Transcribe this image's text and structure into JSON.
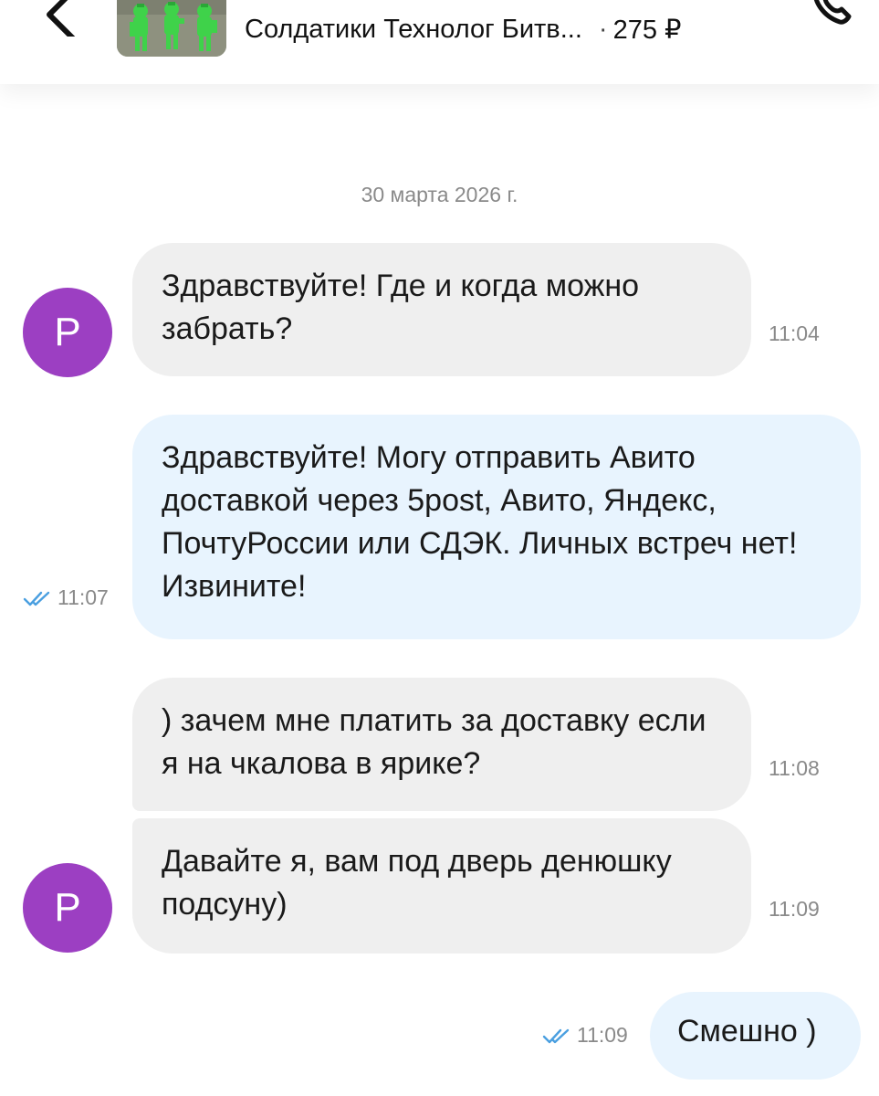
{
  "header": {
    "title": "Солдатики Технолог Битв...",
    "separator": "·",
    "price": "275 ₽",
    "thumbnail_icon": "product-thumbnail"
  },
  "chat": {
    "date": "30 марта 2026 г.",
    "avatar_letter": "P",
    "avatar_color": "#9c3fc2",
    "messages": [
      {
        "direction": "incoming",
        "text": "Здравствуйте! Где и когда можно забрать?",
        "time": "11:04"
      },
      {
        "direction": "outgoing",
        "text": "Здравствуйте! Могу отправить Авито доставкой через 5post, Авито, Яндекс, ПочтуРоссии или СДЭК. Личных встреч нет! Извините!",
        "time": "11:07",
        "read": true
      },
      {
        "direction": "incoming",
        "text": ") зачем мне платить за доставку если я на чкалова в ярике?",
        "time": "11:08"
      },
      {
        "direction": "incoming",
        "text": "Давайте я, вам под дверь денюшку подсуну)",
        "time": "11:09"
      },
      {
        "direction": "outgoing",
        "text": "Смешно )",
        "time": "11:09",
        "read": true
      }
    ]
  },
  "colors": {
    "incoming_bubble": "#efefef",
    "outgoing_bubble": "#e8f4fe",
    "read_check": "#4a9fe0"
  }
}
